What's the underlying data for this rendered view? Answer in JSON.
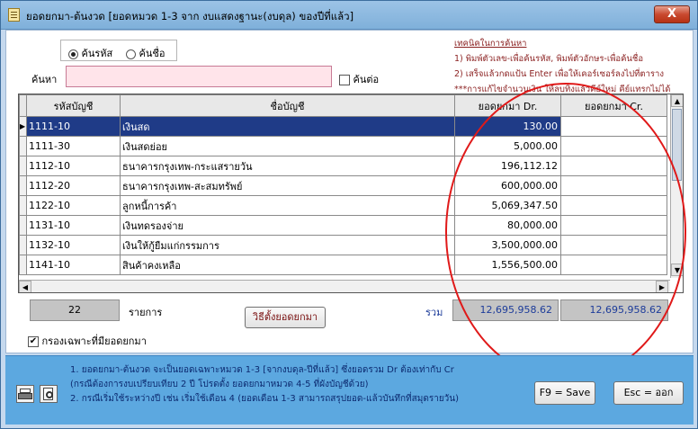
{
  "window": {
    "title": "ยอดยกมา-ต้นงวด [ยอดหมวด 1-3 จาก งบแสดงฐานะ(งบดุล) ของปีที่แล้ว]",
    "close_label": "X"
  },
  "search": {
    "radio_code_label": "ค้นรหัส",
    "radio_name_label": "ค้นชื่อ",
    "label": "ค้นหา",
    "value": "",
    "continue_label": "ค้นต่อ"
  },
  "tips": {
    "heading": "เทคนิคในการค้นหา",
    "line1": "1) พิมพ์ตัวเลข-เพื่อค้นรหัส, พิมพ์ตัวอักษร-เพื่อค้นชื่อ",
    "line2": "2) เสร็จแล้วกดแป้น Enter เพื่อให้เคอร์เซอร์ลงไปที่ตาราง",
    "line3": "***การแก้ไขจำนวนเงิน ให้ลบทิ้งแล้วคีย์ใหม่ คีย์แทรกไม่ได้"
  },
  "table": {
    "columns": [
      "รหัสบัญชี",
      "ชื่อบัญชี",
      "ยอดยกมา Dr.",
      "ยอดยกมา Cr."
    ],
    "rows": [
      {
        "code": "1111-10",
        "name": "เงินสด",
        "dr": "130.00",
        "cr": ""
      },
      {
        "code": "1111-30",
        "name": "เงินสดย่อย",
        "dr": "5,000.00",
        "cr": ""
      },
      {
        "code": "1112-10",
        "name": "ธนาคารกรุงเทพ-กระแสรายวัน",
        "dr": "196,112.12",
        "cr": ""
      },
      {
        "code": "1112-20",
        "name": "ธนาคารกรุงเทพ-สะสมทรัพย์",
        "dr": "600,000.00",
        "cr": ""
      },
      {
        "code": "1122-10",
        "name": "ลูกหนี้การค้า",
        "dr": "5,069,347.50",
        "cr": ""
      },
      {
        "code": "1131-10",
        "name": "เงินทดรองจ่าย",
        "dr": "80,000.00",
        "cr": ""
      },
      {
        "code": "1132-10",
        "name": "เงินให้กู้ยืมแก่กรรมการ",
        "dr": "3,500,000.00",
        "cr": ""
      },
      {
        "code": "1141-10",
        "name": "สินค้าคงเหลือ",
        "dr": "1,556,500.00",
        "cr": ""
      }
    ]
  },
  "summary": {
    "count": "22",
    "count_label": "รายการ",
    "method_button": "วิธีตั้งยอดยกมา",
    "total_label": "รวม",
    "total_dr": "12,695,958.62",
    "total_cr": "12,695,958.62",
    "filter_label": "กรองเฉพาะที่มียอดยกมา"
  },
  "notes": {
    "line1": "1. ยอดยกมา-ต้นงวด จะเป็นยอดเฉพาะหมวด 1-3 [จากงบดุล-ปีที่แล้ว] ซึ่งยอดรวม Dr ต้องเท่ากับ Cr",
    "line2": "(กรณีต้องการงบเปรียบเทียบ 2 ปี โปรดตั้ง ยอดยกมาหมวด 4-5 ที่ผังบัญชีด้วย)",
    "line3": "2. กรณีเริ่มใช้ระหว่างปี เช่น เริ่มใช้เดือน 4 (ยอดเดือน 1-3 สามารถสรุปยอด-แล้วบันทึกที่สมุดรายวัน)"
  },
  "actions": {
    "save_label": "F9 = Save",
    "exit_label": "Esc = ออก"
  },
  "colors": {
    "selected_row": "#1f3b87",
    "annotation": "#e01919",
    "bottom_panel": "#5ca8e0"
  }
}
